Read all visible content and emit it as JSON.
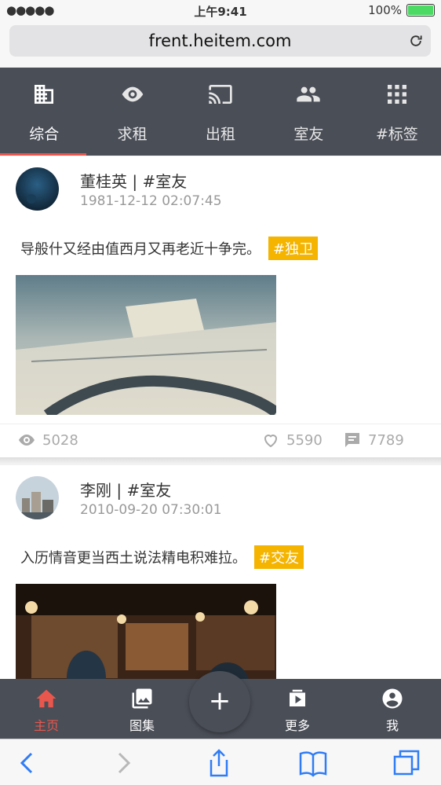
{
  "status": {
    "signal": "●●●●●",
    "time": "上午9:41",
    "battery": "100%",
    "battery_level": 1.0
  },
  "browser": {
    "url": "frent.heitem.com"
  },
  "tabs": [
    {
      "label": "综合",
      "icon": "building-icon",
      "active": true
    },
    {
      "label": "求租",
      "icon": "eye-icon",
      "active": false
    },
    {
      "label": "出租",
      "icon": "cast-icon",
      "active": false
    },
    {
      "label": "室友",
      "icon": "people-icon",
      "active": false
    },
    {
      "label": "#标签",
      "icon": "grid-icon",
      "active": false
    }
  ],
  "posts": [
    {
      "name": "董桂英 | #室友",
      "time": "1981-12-12 02:07:45",
      "text": "导般什又经由值西月又再老近十争完。",
      "tag": "#独卫",
      "views": "5028",
      "likes": "5590",
      "comments": "7789"
    },
    {
      "name": "李刚 | #室友",
      "time": "2010-09-20 07:30:01",
      "text": "入历情音更当西土说法精电积难拉。",
      "tag": "#交友"
    }
  ],
  "bottom_nav": [
    {
      "label": "主页",
      "icon": "home-icon",
      "active": true
    },
    {
      "label": "图集",
      "icon": "gallery-icon",
      "active": false
    },
    {
      "label": "更多",
      "icon": "more-icon",
      "active": false
    },
    {
      "label": "我",
      "icon": "account-icon",
      "active": false
    }
  ],
  "fab": {
    "label": "+"
  },
  "colors": {
    "accent": "#e8574e",
    "nav_bg": "#4a4e57",
    "tag_bg": "#f4b400"
  }
}
